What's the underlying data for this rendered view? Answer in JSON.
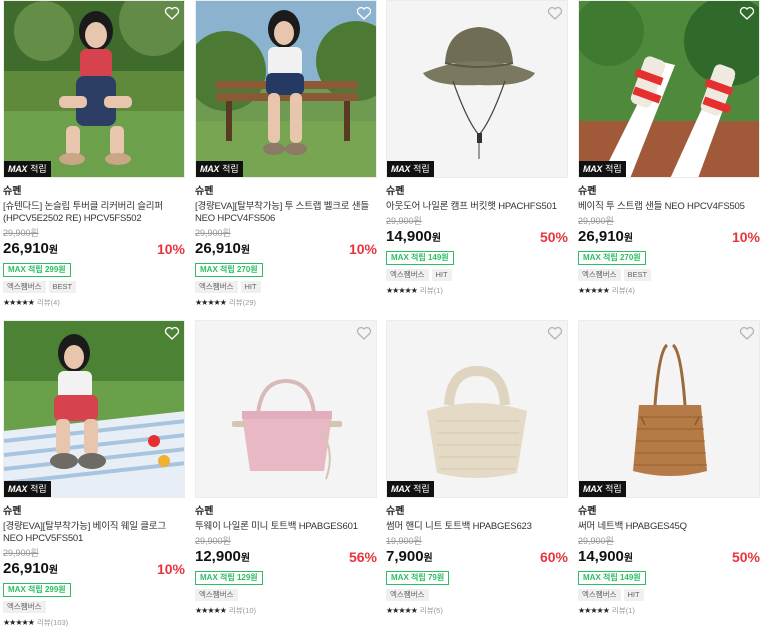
{
  "badge": {
    "max_label": "MAX",
    "earn_label": "적립"
  },
  "products": [
    {
      "brand": "슈펜",
      "name": "[슈텐다드] 논슬립 투버클 리커버리 슬리퍼 (HPCV5E2502 RE) HPCV5FS502",
      "original_price": "29,900원",
      "price": "26,910",
      "won": "원",
      "discount": "10%",
      "points": "MAX 적립 299원",
      "tags": [
        "엑스쨈버스",
        "BEST"
      ],
      "stars": "★★★★★",
      "review": "리뷰(4)",
      "image": "model-green"
    },
    {
      "brand": "슈펜",
      "name": "[경량EVA][탈부착가능] 투 스트랩 벨크로 샌들 NEO HPCV4FS506",
      "original_price": "29,900원",
      "price": "26,910",
      "won": "원",
      "discount": "10%",
      "points": "MAX 적립 270원",
      "tags": [
        "엑스쨈버스",
        "HIT"
      ],
      "stars": "★★★★★",
      "review": "리뷰(29)",
      "image": "model-bench"
    },
    {
      "brand": "슈펜",
      "name": "아웃도어 나일론 캠프 버킷햇 HPACHFS501",
      "original_price": "29,900원",
      "price": "14,900",
      "won": "원",
      "discount": "50%",
      "points": "MAX 적립 149원",
      "tags": [
        "엑스쨈버스",
        "HIT"
      ],
      "stars": "★★★★★",
      "review": "리뷰(1)",
      "image": "bucket-hat"
    },
    {
      "brand": "슈펜",
      "name": "베이직 투 스트랩 샌들 NEO HPCV4FS505",
      "original_price": "29,900원",
      "price": "26,910",
      "won": "원",
      "discount": "10%",
      "points": "MAX 적립 270원",
      "tags": [
        "엑스쨈버스",
        "BEST"
      ],
      "stars": "★★★★★",
      "review": "리뷰(4)",
      "image": "sandal-legs"
    },
    {
      "brand": "슈펜",
      "name": "[경량EVA][탈부착가능] 베이직 웨일 클로그 NEO HPCV5FS501",
      "original_price": "29,900원",
      "price": "26,910",
      "won": "원",
      "discount": "10%",
      "points": "MAX 적립 299원",
      "tags": [
        "엑스쨈버스"
      ],
      "stars": "★★★★★",
      "review": "리뷰(103)",
      "image": "model-picnic"
    },
    {
      "brand": "슈펜",
      "name": "투웨이 나일론 미니 토트백 HPABGES601",
      "original_price": "29,900원",
      "price": "12,900",
      "won": "원",
      "discount": "56%",
      "points": "MAX 적립 129원",
      "tags": [
        "엑스쨈버스"
      ],
      "stars": "★★★★★",
      "review": "리뷰(10)",
      "image": "pink-tote"
    },
    {
      "brand": "슈펜",
      "name": "썸머 핸디 니트 토트백 HPABGES623",
      "original_price": "19,900원",
      "price": "7,900",
      "won": "원",
      "discount": "60%",
      "points": "MAX 적립 79원",
      "tags": [
        "엑스쨈버스"
      ],
      "stars": "★★★★★",
      "review": "리뷰(5)",
      "image": "knit-tote"
    },
    {
      "brand": "슈펜",
      "name": "써머 네트백 HPABGES45Q",
      "original_price": "29,900원",
      "price": "14,900",
      "won": "원",
      "discount": "50%",
      "points": "MAX 적립 149원",
      "tags": [
        "엑스쨈버스",
        "HIT"
      ],
      "stars": "★★★★★",
      "review": "리뷰(1)",
      "image": "net-bag"
    }
  ],
  "colors": {
    "discount": "#e8353b",
    "points": "#2dbd63",
    "badge_bg": "#111111"
  }
}
